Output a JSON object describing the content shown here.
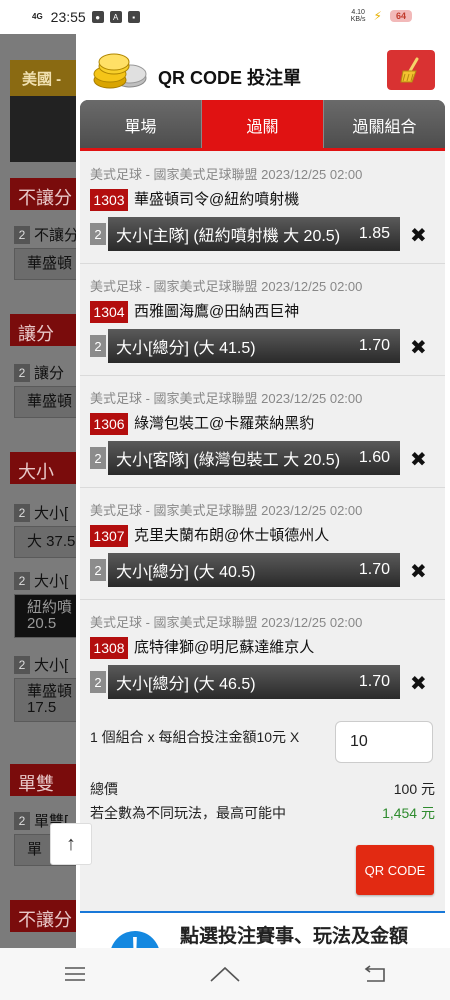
{
  "status_bar": {
    "network": "4G",
    "time": "23:55",
    "speed": "4.10",
    "speed_unit": "KB/s",
    "battery": "64"
  },
  "background_page": {
    "league_header": "美國 -",
    "sections": [
      {
        "title": "不讓分",
        "row_label": "不讓分",
        "row_num": "2",
        "button": "華盛頓"
      },
      {
        "title": "讓分",
        "row_label": "讓分",
        "row_num": "2",
        "button": "華盛頓"
      },
      {
        "title": "大小",
        "rows": [
          {
            "num": "2",
            "label": "大小[",
            "button": "大 37.5"
          },
          {
            "num": "2",
            "label": "大小[",
            "button_line1": "紐約噴",
            "button_line2": "20.5"
          },
          {
            "num": "2",
            "label": "大小[",
            "button_line1": "華盛頓",
            "button_line2": "17.5"
          }
        ]
      },
      {
        "title": "單雙",
        "row_label": "單雙[",
        "row_num": "2",
        "button": "單"
      },
      {
        "title": "不讓分"
      }
    ],
    "scroll_top_icon": "↑"
  },
  "panel": {
    "title": "QR CODE 投注單",
    "tabs": [
      {
        "label": "單場",
        "active": false
      },
      {
        "label": "過關",
        "active": true
      },
      {
        "label": "過關組合",
        "active": false
      }
    ],
    "bets": [
      {
        "league": "美式足球 - 國家美式足球聯盟 2023/12/25 02:00",
        "code": "1303",
        "teams": "華盛頓司令@紐約噴射機",
        "n": "2",
        "selection": "大小[主隊] (紐約噴射機 大 20.5)",
        "odds": "1.85"
      },
      {
        "league": "美式足球 - 國家美式足球聯盟 2023/12/25 02:00",
        "code": "1304",
        "teams": "西雅圖海鷹@田納西巨神",
        "n": "2",
        "selection": "大小[總分] (大 41.5)",
        "odds": "1.70"
      },
      {
        "league": "美式足球 - 國家美式足球聯盟 2023/12/25 02:00",
        "code": "1306",
        "teams": "綠灣包裝工@卡羅萊納黑豹",
        "n": "2",
        "selection": "大小[客隊] (綠灣包裝工 大 20.5)",
        "odds": "1.60"
      },
      {
        "league": "美式足球 - 國家美式足球聯盟 2023/12/25 02:00",
        "code": "1307",
        "teams": "克里夫蘭布朗@休士頓德州人",
        "n": "2",
        "selection": "大小[總分] (大 40.5)",
        "odds": "1.70"
      },
      {
        "league": "美式足球 - 國家美式足球聯盟 2023/12/25 02:00",
        "code": "1308",
        "teams": "底特律獅@明尼蘇達維京人",
        "n": "2",
        "selection": "大小[總分] (大 46.5)",
        "odds": "1.70"
      }
    ],
    "remove_icon": "✖",
    "summary": {
      "combo_text": "1 個組合 x 每組合投注金額10元 X",
      "amount": "10",
      "total_label": "總價",
      "total_value": "100 元",
      "max_label": "若全數為不同玩法，最高可能中",
      "max_value": "1,454 元",
      "max_color": "#2e8b2e",
      "qr_button": "QR CODE"
    },
    "info_banner": {
      "icon": "!",
      "text": "點選投注賽事、玩法及金額"
    }
  },
  "accent_red": "#e01212"
}
